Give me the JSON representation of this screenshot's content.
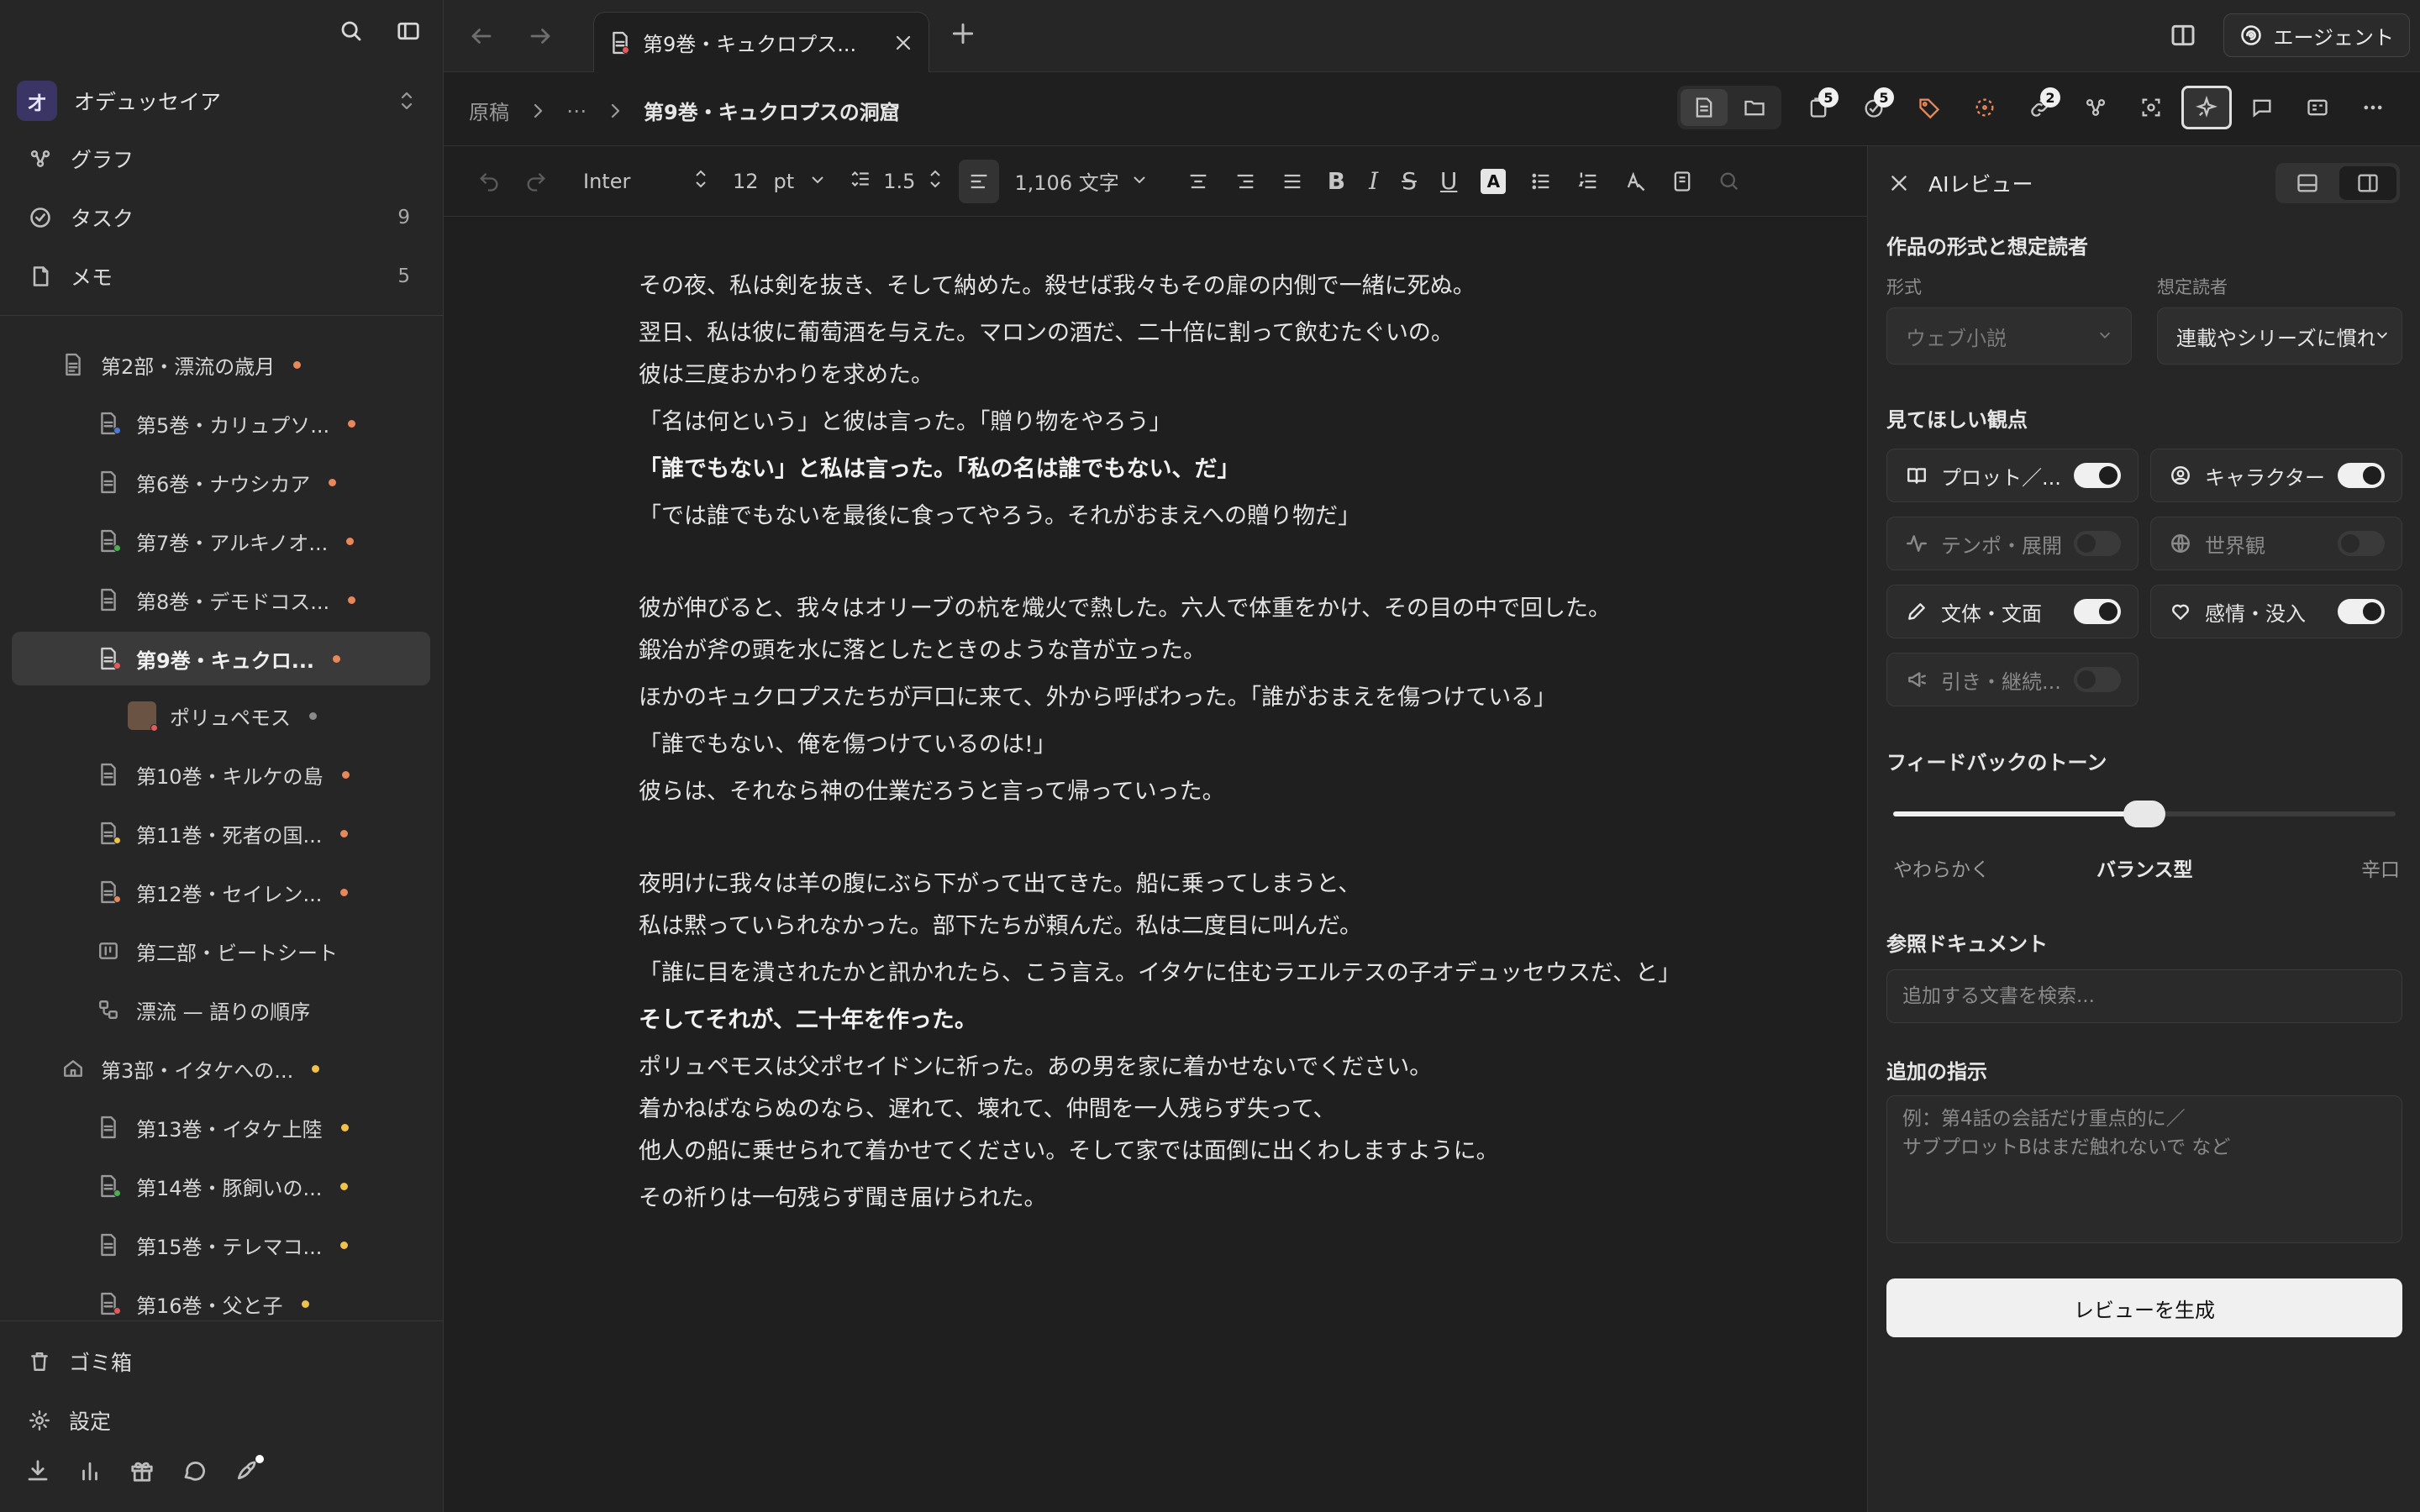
{
  "sidebar": {
    "workspace": {
      "initial": "オ",
      "name": "オデュッセイア"
    },
    "nav": [
      {
        "label": "グラフ",
        "count": ""
      },
      {
        "label": "タスク",
        "count": "9"
      },
      {
        "label": "メモ",
        "count": "5"
      }
    ],
    "tree": [
      {
        "label": "第2部・漂流の歳月",
        "dot": "#e8875a"
      },
      {
        "label": "第5巻・カリュプソ...",
        "dot": "#e8875a"
      },
      {
        "label": "第6巻・ナウシカア",
        "dot": "#e8875a"
      },
      {
        "label": "第7巻・アルキノオ...",
        "dot": "#e8875a"
      },
      {
        "label": "第8巻・デモドコス...",
        "dot": "#e8875a"
      },
      {
        "label": "第9巻・キュクロ...",
        "dot": "#e8875a"
      },
      {
        "label": "ポリュペモス",
        "dot": "#8a8a8a"
      },
      {
        "label": "第10巻・キルケの島",
        "dot": "#e8875a"
      },
      {
        "label": "第11巻・死者の国...",
        "dot": "#e8875a"
      },
      {
        "label": "第12巻・セイレン...",
        "dot": "#e8875a"
      },
      {
        "label": "第二部・ビートシート",
        "dot": ""
      },
      {
        "label": "漂流 — 語りの順序",
        "dot": ""
      },
      {
        "label": "第3部・イタケへの...",
        "dot": "#f0c24a"
      },
      {
        "label": "第13巻・イタケ上陸",
        "dot": "#f0c24a"
      },
      {
        "label": "第14巻・豚飼いの...",
        "dot": "#f0c24a"
      },
      {
        "label": "第15巻・テレマコ...",
        "dot": "#f0c24a"
      },
      {
        "label": "第16巻・父と子",
        "dot": "#f0c24a"
      }
    ],
    "trash": "ゴミ箱",
    "settings": "設定"
  },
  "tabs": [
    {
      "label": "第9巻・キュクロプス..."
    }
  ],
  "agent_button": "エージェント",
  "breadcrumb": {
    "root": "原稿",
    "ellipsis": "⋯",
    "current": "第9巻・キュクロプスの洞窟"
  },
  "toolbar_counts": {
    "pages": "5",
    "tasks": "5",
    "links": "2"
  },
  "format": {
    "font": "Inter",
    "size": "12",
    "size_unit": "pt",
    "line_height": "1.5",
    "word_count": "1,106 文字",
    "color_glyph": "A"
  },
  "editor": {
    "paragraphs": [
      {
        "text": "その夜、私は剣を抜き、そして納めた。殺せば我々もその扉の内側で一緒に死ぬ。",
        "bold": false
      },
      {
        "text": "翌日、私は彼に葡萄酒を与えた。マロンの酒だ、二十倍に割って飲むたぐいの。",
        "bold": false
      },
      {
        "text": "彼は三度おかわりを求めた。",
        "bold": false
      },
      {
        "text": "「名は何という」と彼は言った。「贈り物をやろう」",
        "bold": false
      },
      {
        "text": "「誰でもない」と私は言った。「私の名は誰でもない、だ」",
        "bold": true
      },
      {
        "text": "「では誰でもないを最後に食ってやろう。それがおまえへの贈り物だ」",
        "bold": false
      },
      {
        "text": "彼が伸びると、我々はオリーブの杭を熾火で熱した。六人で体重をかけ、その目の中で回した。",
        "bold": false
      },
      {
        "text": "鍛冶が斧の頭を水に落としたときのような音が立った。",
        "bold": false
      },
      {
        "text": "ほかのキュクロプスたちが戸口に来て、外から呼ばわった。「誰がおまえを傷つけている」",
        "bold": false
      },
      {
        "text": "「誰でもない、俺を傷つけているのは!」",
        "bold": false
      },
      {
        "text": "彼らは、それなら神の仕業だろうと言って帰っていった。",
        "bold": false
      },
      {
        "text": "夜明けに我々は羊の腹にぶら下がって出てきた。船に乗ってしまうと、",
        "bold": false
      },
      {
        "text": "私は黙っていられなかった。部下たちが頼んだ。私は二度目に叫んだ。",
        "bold": false
      },
      {
        "text": "「誰に目を潰されたかと訊かれたら、こう言え。イタケに住むラエルテスの子オデュッセウスだ、と」",
        "bold": false
      },
      {
        "text": "そしてそれが、二十年を作った。",
        "bold": true
      },
      {
        "text": "ポリュペモスは父ポセイドンに祈った。あの男を家に着かせないでください。",
        "bold": false
      },
      {
        "text": "着かねばならぬのなら、遅れて、壊れて、仲間を一人残らず失って、",
        "bold": false
      },
      {
        "text": "他人の船に乗せられて着かせてください。そして家では面倒に出くわしますように。",
        "bold": false
      },
      {
        "text": "その祈りは一句残らず聞き届けられた。",
        "bold": false
      }
    ]
  },
  "review_panel": {
    "title": "AIレビュー",
    "section_form": "作品の形式と想定読者",
    "format_label": "形式",
    "format_value": "ウェブ小説",
    "reader_label": "想定読者",
    "reader_value": "連載やシリーズに慣れた",
    "section_aspects": "見てほしい観点",
    "aspects": [
      {
        "label": "プロット／...",
        "on": true
      },
      {
        "label": "キャラクター",
        "on": true
      },
      {
        "label": "テンポ・展開",
        "on": false
      },
      {
        "label": "世界観",
        "on": false
      },
      {
        "label": "文体・文面",
        "on": true
      },
      {
        "label": "感情・没入",
        "on": true
      },
      {
        "label": "引き・継続...",
        "on": false
      }
    ],
    "section_tone": "フィードバックのトーン",
    "tone_level": 0.5,
    "tone_labels": {
      "soft": "やわらかく",
      "balanced": "バランス型",
      "harsh": "辛口"
    },
    "section_refs": "参照ドキュメント",
    "ref_placeholder": "追加する文書を検索...",
    "section_instructions": "追加の指示",
    "instructions_placeholder_1": "例：第4話の会話だけ重点的に／",
    "instructions_placeholder_2": "サブプロットBはまだ触れないで など",
    "generate_button": "レビューを生成"
  }
}
